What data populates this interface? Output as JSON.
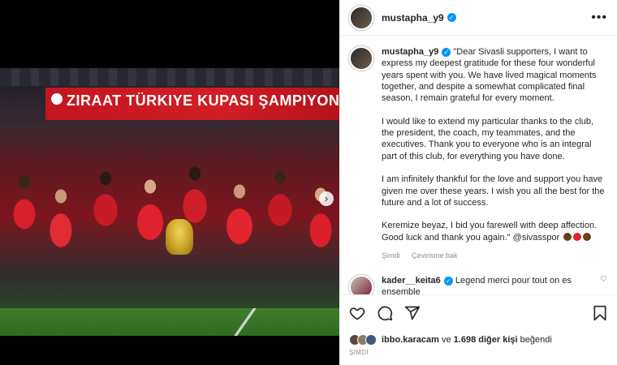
{
  "post": {
    "author": "mustapha_y9",
    "media": {
      "banner_text": "ZIRAAT TÜRKIYE KUPASI ŞAMPIYONU"
    }
  },
  "caption": {
    "username": "mustapha_y9",
    "paragraphs": [
      "\"Dear Sivasli supporters, I want to express my deepest gratitude for these four wonderful years spent with you. We have lived magical moments together, and despite a somewhat complicated final season, I remain grateful for every moment.",
      "I would like to extend my particular thanks to the club, the president, the coach, my teammates, and the executives. Thank you to everyone who is an integral part of this club, for everything you have done.",
      "I am infinitely thankful for the love and support you have given me over these years. I wish you all the best for the future and a lot of success.",
      "Keremize beyaz, I bid you farewell with deep affection. Good luck and thank you again.\" @sivasspor"
    ],
    "emojis": [
      "brown-heart",
      "red-heart",
      "brown-heart"
    ],
    "time": "Şimdi",
    "translate": "Çevirisine bak"
  },
  "comment": {
    "username": "kader__keita6",
    "text": "Legend merci pour tout on es ensemble"
  },
  "likes": {
    "user": "ibbo.karacam",
    "connector": "ve",
    "count": "1.698 diğer kişi",
    "suffix": "beğendi"
  },
  "timestamp": "ŞIMDI",
  "colors": {
    "verified": "#0095f6",
    "team_red": "#d21d26",
    "text": "#262626",
    "muted": "#8e8e8e"
  }
}
